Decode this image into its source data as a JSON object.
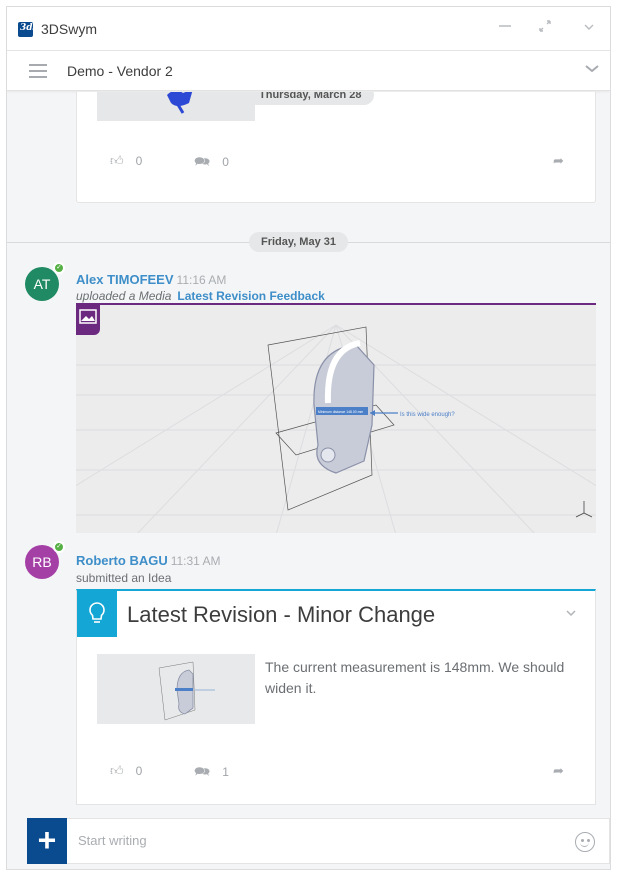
{
  "app": {
    "logo_text": "3ds",
    "title": "3DSwym"
  },
  "window_controls": {
    "minimize": "—",
    "expand": "⤢",
    "collapse": "⌄"
  },
  "community": {
    "title": "Demo - Vendor 2"
  },
  "feed": {
    "first_post": {
      "date": "Thursday, March 28",
      "likes": "0",
      "comments": "0"
    },
    "separator_date": "Friday, May 31",
    "media_post": {
      "initials": "AT",
      "avatar_color": "#1f8a63",
      "author": "Alex TIMOFEEV",
      "time": "11:16 AM",
      "verb": "uploaded a Media",
      "link_title": "Latest Revision Feedback",
      "annotation": "Is this wide enough?",
      "dimension": "Minimum distance 148.00 mm"
    },
    "idea_post": {
      "initials": "RB",
      "avatar_color": "#a43fa6",
      "author": "Roberto BAGU",
      "time": "11:31 AM",
      "verb": "submitted an Idea",
      "title": "Latest Revision - Minor Change",
      "body": "The current measurement is 148mm.  We should widen it.",
      "likes": "0",
      "comments": "1"
    }
  },
  "composer": {
    "placeholder": "Start writing",
    "plus": "+"
  },
  "colors": {
    "brand": "#0a4a8f",
    "idea_accent": "#14a6d4",
    "media_accent": "#6b2a7f",
    "link": "#3d8ec9",
    "online": "#56b045"
  },
  "icons": {
    "like": "thumbs-up-icon",
    "comment": "comment-icon",
    "share": "share-icon"
  }
}
